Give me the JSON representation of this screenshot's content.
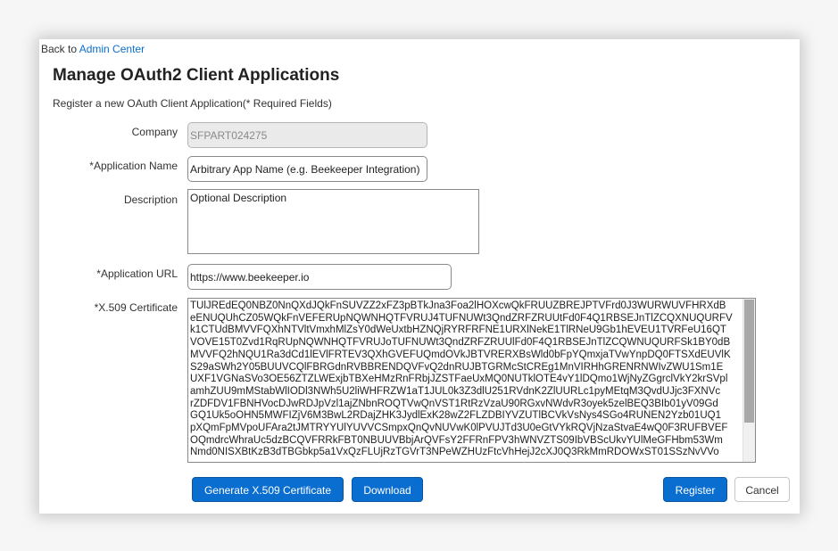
{
  "nav": {
    "back_prefix": "Back to ",
    "back_link": "Admin Center"
  },
  "page": {
    "title": "Manage OAuth2 Client Applications",
    "subtitle": "Register a new OAuth Client Application(* Required Fields)"
  },
  "form": {
    "company": {
      "label": "Company",
      "value": "SFPART024275"
    },
    "app_name": {
      "label": "*Application Name",
      "value": "Arbitrary App Name (e.g. Beekeeper Integration)"
    },
    "description": {
      "label": "Description",
      "value": "Optional Description"
    },
    "app_url": {
      "label": "*Application URL",
      "value": "https://www.beekeeper.io"
    },
    "certificate": {
      "label": "*X.509 Certificate",
      "value": "TUlJREdEQ0NBZ0NnQXdJQkFnSUVZZ2xFZ3pBTkJna3Foa2lHOXcwQkFRUUZBREJPTVFrd0J3WURWUVFHRXdB\neENUQUhCZ05WQkFnVEFERUpNQWNHQTFVRUJ4TUFNUWt3QndZRFZRUUtFd0F4Q1RBSEJnTlZCQXNUQURFV\nk1CTUdBMVVFQXhNTVltVmxhMlZsY0dWeUxtbHZNQjRYRFRFNE1URXlNekE1TlRNeU9Gb1hEVEU1TVRFeU16QT\nVOVE15T0Zvd1RqRUpNQWNHQTFVRUJoTUFNUWt3QndZRFZRUUlFd0F4Q1RBSEJnTlZCQWNUQURFSk1BY0dB\nMVVFQ2hNQU1Ra3dCd1lEVlFRTEV3QXhGVEFUQmdOVkJBTVRERXBsWld0bFpYQmxjaTVwYnpDQ0FTSXdEUVlK\nS29aSWh2Y05BUUVCQlFBRGdnRVBBRENDQVFvQ2dnRUJBTGRMcStCREg1MnVIRHhGRENRNWIvZWU1Sm1E\nUXF1VGNaSVo3OE56ZTZLWExjbTBXeHMzRnFRbjJZSTFaeUxMQ0NUTklOTE4vY1lDQmo1WjNyZGgrclVkY2krSVpl\namhZUU9mMStabWlIODl3NWh5U2liWHFRZW1aT1JUL0k3Z3dlU251RVdnK2ZlUURLc1pyMEtqM3QvdUJjc3FXNVc\nrZDFDV1FBNHVocDJwRDJpVzl1ajZNbnROQTVwQnVST1RtRzVzaU90RGxvNWdvR3oyek5zelBEQ3BIb01yV09Gd\nGQ1Uk5oOHN5MWFIZjV6M3BwL2RDajZHK3JydlExK28wZ2FLZDBIYVZUTlBCVkVsNys4SGo4RUNEN2Yzb01UQ1\npXQmFpMVpoUFAra2tJMTRYYUlYUVVCSmpxQnQvNUVwK0lPVUJTd3U0eGtVYkRQVjNzaStvaE4wQ0F3RUFBVEF\nOQmdrcWhraUc5dzBCQVFRRkFBT0NBUUVBbjArQVFsY2FFRnFPV3hWNVZTS09IbVBScUkvYUlMeGFHbm53Wm\nNmd0NISXBtKzB3dTBGbkp5a1VxQzFLUjRzTGVrT3NPeWZHUzFtcVhHejJ2cXJ0Q3RkMmRDOWxST01SSzNvVVo"
    }
  },
  "buttons": {
    "generate": "Generate X.509 Certificate",
    "download": "Download",
    "register": "Register",
    "cancel": "Cancel"
  }
}
